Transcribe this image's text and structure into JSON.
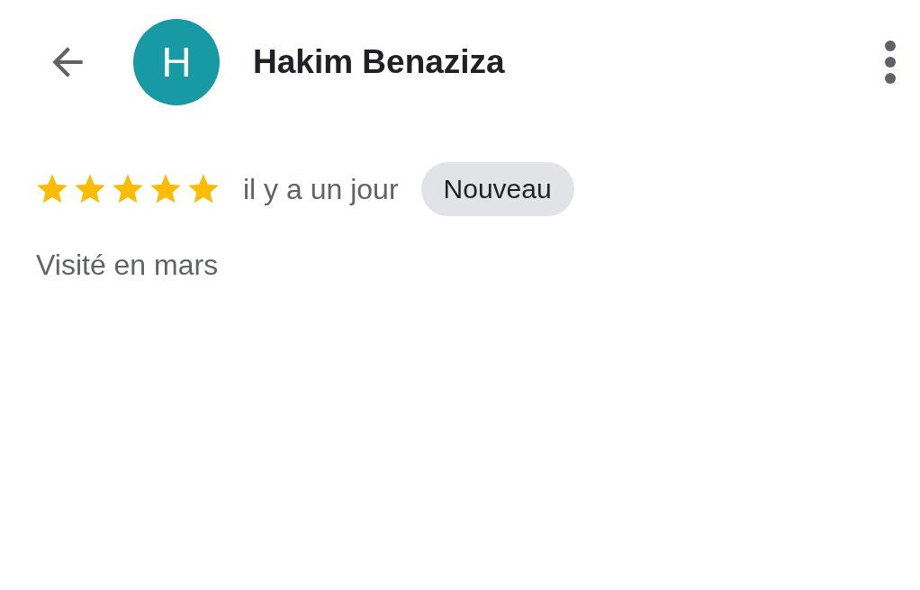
{
  "header": {
    "avatar_letter": "H",
    "name": "Hakim Benaziza"
  },
  "review": {
    "stars": 5,
    "time": "il y a un jour",
    "badge": "Nouveau",
    "visit": "Visité en mars"
  }
}
